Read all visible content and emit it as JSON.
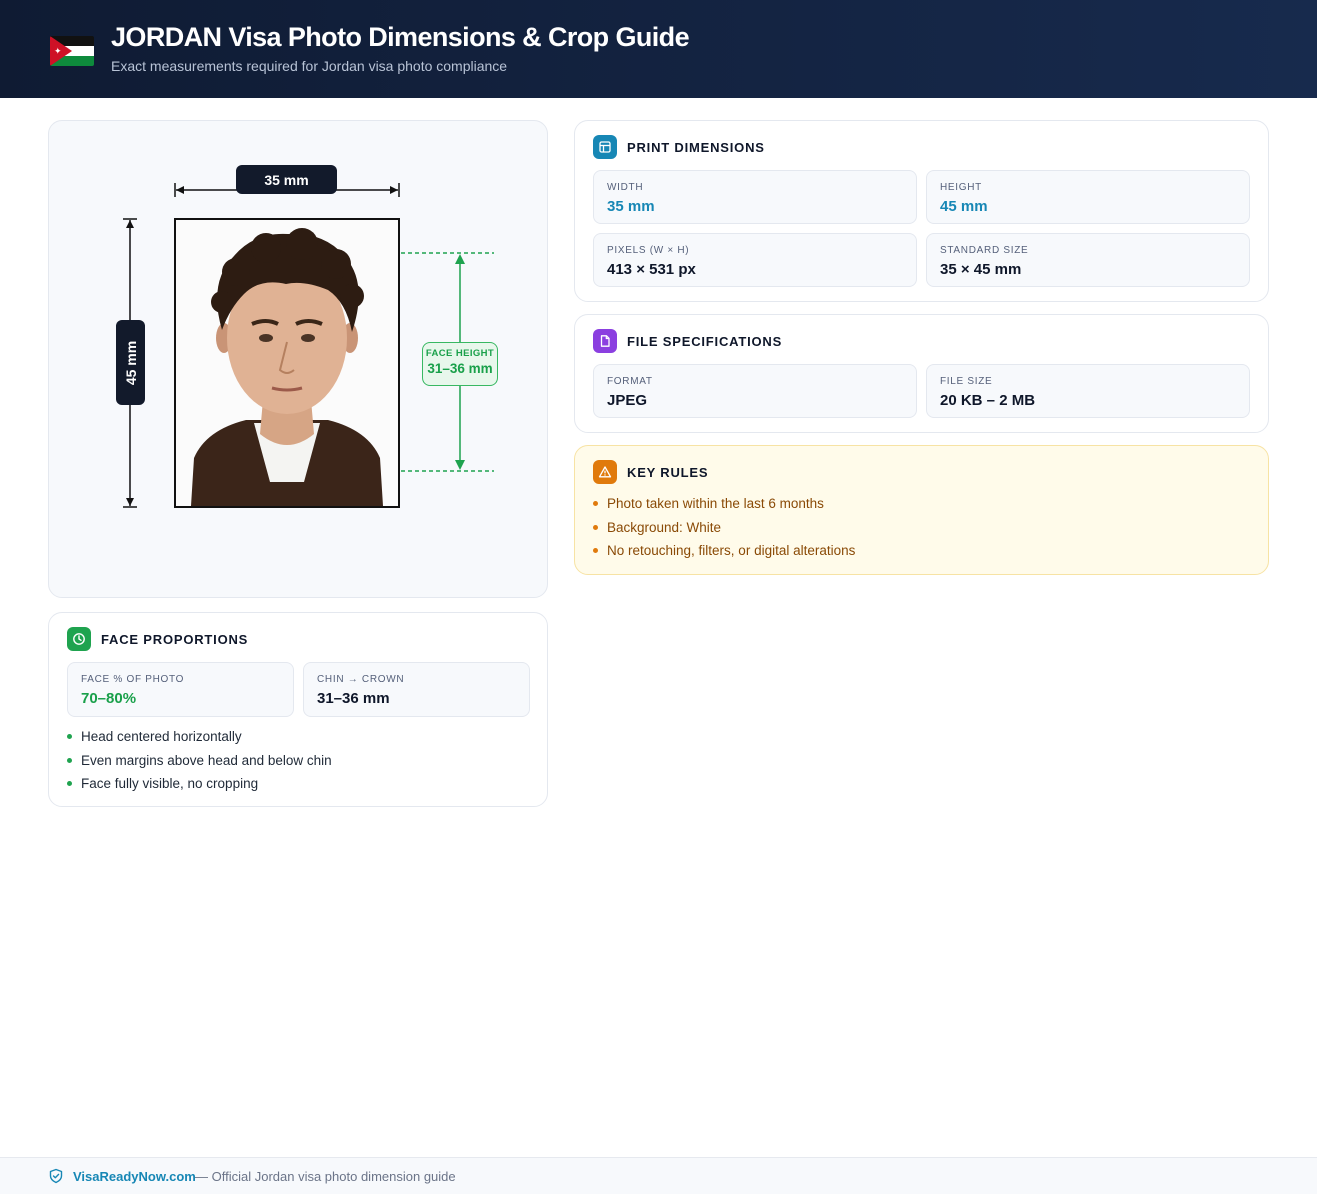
{
  "header": {
    "title": "JORDAN Visa Photo Dimensions & Crop Guide",
    "subtitle": "Exact measurements required for Jordan visa photo compliance",
    "flag_icon": "jordan-flag-icon"
  },
  "diagram": {
    "width_label": "35 mm",
    "height_label": "45 mm",
    "face_height_title": "FACE HEIGHT",
    "face_height_value": "31–36 mm",
    "photo": "portrait-photo",
    "guide_color": "#1fa34f"
  },
  "face_proportions": {
    "title": "FACE PROPORTIONS",
    "icon": "clock-icon",
    "stats": [
      {
        "label": "FACE % OF PHOTO",
        "value": "70–80%"
      },
      {
        "label": "CHIN → CROWN",
        "value": "31–36 mm"
      }
    ],
    "bullets": [
      "Head centered horizontally",
      "Even margins above head and below chin",
      "Face fully visible, no cropping"
    ]
  },
  "print_dimensions": {
    "title": "PRINT DIMENSIONS",
    "icon": "layout-icon",
    "stats": [
      {
        "label": "WIDTH",
        "value": "35 mm"
      },
      {
        "label": "HEIGHT",
        "value": "45 mm"
      },
      {
        "label": "PIXELS (W × H)",
        "value": "413 × 531 px"
      },
      {
        "label": "STANDARD SIZE",
        "value": "35 × 45 mm"
      }
    ]
  },
  "file_specifications": {
    "title": "FILE SPECIFICATIONS",
    "icon": "file-icon",
    "stats": [
      {
        "label": "FORMAT",
        "value": "JPEG"
      },
      {
        "label": "FILE SIZE",
        "value": "20 KB – 2 MB"
      }
    ]
  },
  "key_rules": {
    "title": "KEY RULES",
    "icon": "warning-icon",
    "bullets": [
      "Photo taken within the last 6 months",
      "Background: White",
      "No retouching, filters, or digital alterations"
    ]
  },
  "footer": {
    "brand": "VisaReadyNow.com",
    "note": "— Official Jordan visa photo dimension guide",
    "icon": "shield-icon"
  },
  "colors": {
    "header_bg": "#0f1b33",
    "accent_blue": "#1787b5",
    "accent_green": "#1fa34f",
    "accent_purple": "#8b3fe0",
    "accent_amber": "#e07a0c",
    "rules_bg": "#fffbea"
  }
}
